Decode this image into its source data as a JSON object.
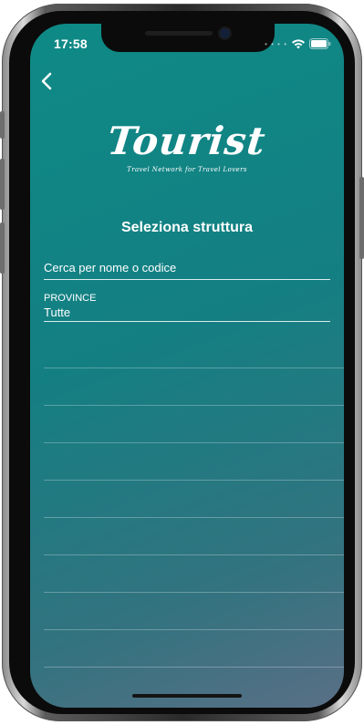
{
  "status_bar": {
    "time": "17:58",
    "signal_dots": "• • • •"
  },
  "nav": {
    "back_icon": "chevron-left-icon"
  },
  "logo": {
    "wordmark": "Tourist",
    "tagline": "Travel Network for Travel Lovers"
  },
  "page": {
    "title": "Seleziona struttura"
  },
  "search": {
    "placeholder": "Cerca per nome o codice",
    "value": ""
  },
  "filter": {
    "label": "PROVINCE",
    "value": "Tutte"
  },
  "results": {
    "rows": [
      "",
      "",
      "",
      "",
      "",
      "",
      "",
      "",
      ""
    ]
  },
  "colors": {
    "gradient_start": "#0e8a86",
    "gradient_end": "#5a6f86",
    "text": "#ffffff"
  }
}
